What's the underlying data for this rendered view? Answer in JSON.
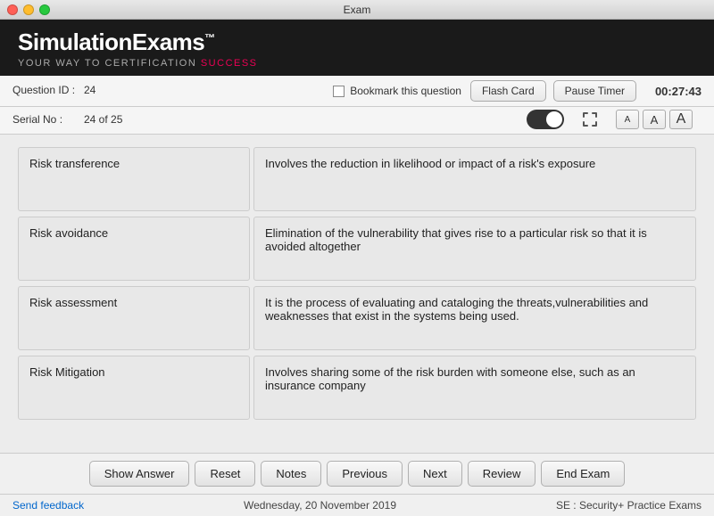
{
  "titlebar": {
    "title": "Exam"
  },
  "brand": {
    "name": "SimulationExams",
    "tm": "™",
    "tagline_normal": "YOUR WAY TO CERTIFICATION ",
    "tagline_highlight": "SUCCESS"
  },
  "info": {
    "question_id_label": "Question ID :",
    "question_id_value": "24",
    "serial_no_label": "Serial No :",
    "serial_no_value": "24 of 25",
    "bookmark_label": "Bookmark this question",
    "flash_card_label": "Flash Card",
    "pause_timer_label": "Pause Timer",
    "timer_value": "00:27:43"
  },
  "font_buttons": {
    "small": "A",
    "medium": "A",
    "large": "A"
  },
  "flashcards": [
    {
      "term": "Risk transference",
      "definition": "Involves the reduction in likelihood or impact of a risk's exposure"
    },
    {
      "term": "Risk avoidance",
      "definition": "Elimination of the vulnerability that gives rise to a particular risk so that it is avoided altogether"
    },
    {
      "term": "Risk assessment",
      "definition": "It is the process of evaluating and cataloging the threats,vulnerabilities and weaknesses that exist in the systems being used."
    },
    {
      "term": "Risk Mitigation",
      "definition": "Involves sharing some of the risk burden with someone else, such as an insurance company"
    }
  ],
  "buttons": {
    "show_answer": "Show Answer",
    "reset": "Reset",
    "notes": "Notes",
    "previous": "Previous",
    "next": "Next",
    "review": "Review",
    "end_exam": "End Exam"
  },
  "footer": {
    "feedback": "Send feedback",
    "date": "Wednesday, 20 November 2019",
    "course": "SE : Security+ Practice Exams"
  }
}
